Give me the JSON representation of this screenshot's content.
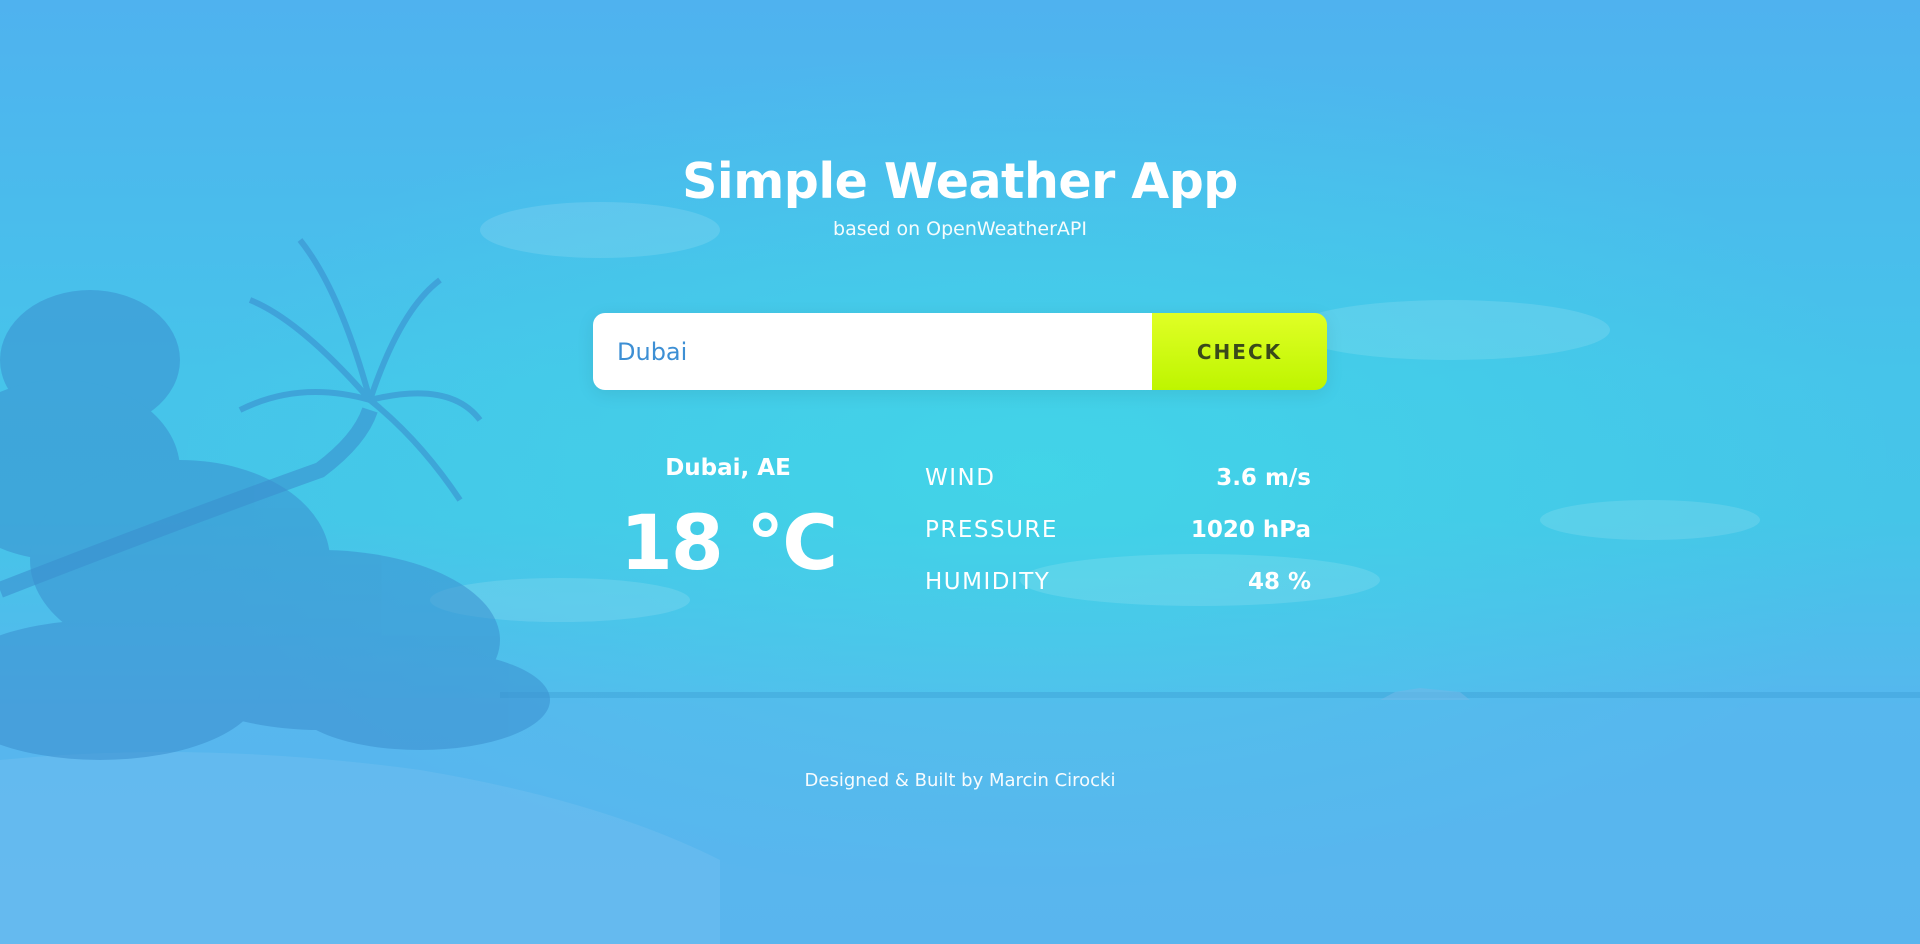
{
  "header": {
    "title": "Simple Weather App",
    "subtitle": "based on OpenWeatherAPI"
  },
  "search": {
    "value": "Dubai",
    "placeholder": "",
    "button_label": "CHECK"
  },
  "weather": {
    "location": "Dubai, AE",
    "temperature": "18 °C",
    "stats": [
      {
        "label": "WIND",
        "value": "3.6 m/s"
      },
      {
        "label": "PRESSURE",
        "value": "1020 hPa"
      },
      {
        "label": "HUMIDITY",
        "value": "48 %"
      }
    ]
  },
  "footer": {
    "credit": "Designed & Built by Marcin Cirocki"
  },
  "colors": {
    "background": "#4fb2ef",
    "accent_button": "#d4fb14",
    "input_text": "#3d8fd4",
    "text": "#ffffff"
  }
}
